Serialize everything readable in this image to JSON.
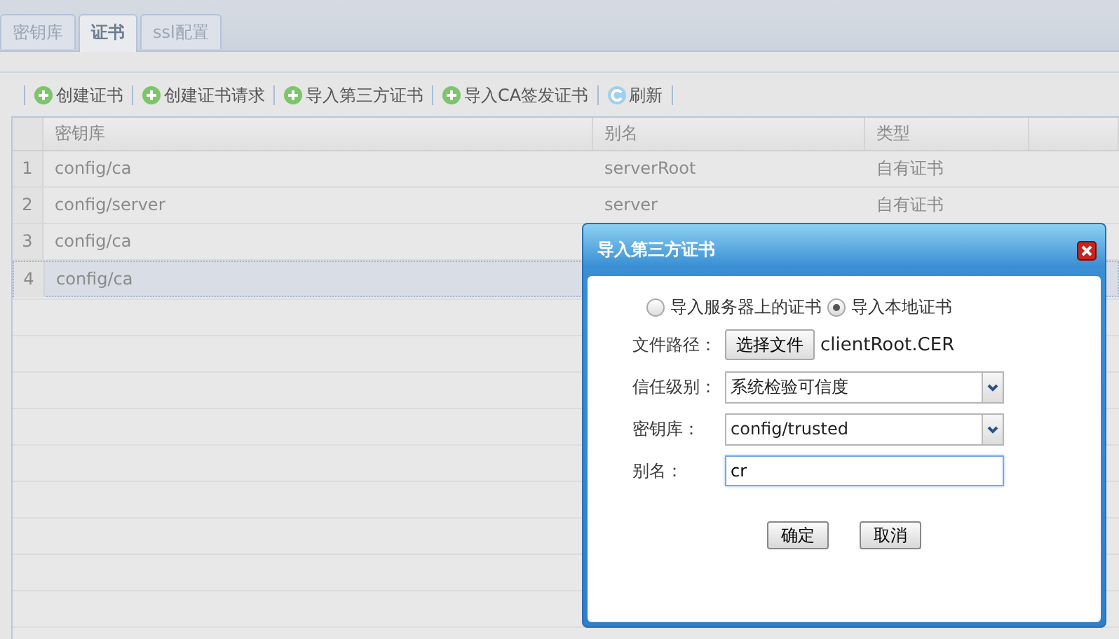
{
  "tabs": [
    {
      "label": "密钥库",
      "selected": false
    },
    {
      "label": "证书",
      "selected": true
    },
    {
      "label": "ssl配置",
      "selected": false
    }
  ],
  "toolbar": [
    {
      "label": "创建证书",
      "kind": "add"
    },
    {
      "label": "创建证书请求",
      "kind": "add"
    },
    {
      "label": "导入第三方证书",
      "kind": "add"
    },
    {
      "label": "导入CA签发证书",
      "kind": "add"
    },
    {
      "label": "刷新",
      "kind": "refresh"
    }
  ],
  "table": {
    "columns": [
      "密钥库",
      "别名",
      "类型"
    ],
    "rows": [
      {
        "number": "1",
        "cells": [
          "config/ca",
          "serverRoot",
          "自有证书"
        ],
        "selected": false
      },
      {
        "number": "2",
        "cells": [
          "config/server",
          "server",
          "自有证书"
        ],
        "selected": false
      },
      {
        "number": "3",
        "cells": [
          "config/ca"
        ],
        "selected": false
      },
      {
        "number": "4",
        "cells": [
          "config/ca"
        ],
        "selected": true
      }
    ]
  },
  "dialog": {
    "title": "导入第三方证书",
    "radios": [
      {
        "label": "导入服务器上的证书",
        "selected": false
      },
      {
        "label": "导入本地证书",
        "selected": true
      }
    ],
    "fields": [
      {
        "kind": "file",
        "label": "文件路径：",
        "button": "选择文件",
        "value": "clientRoot.CER"
      },
      {
        "kind": "select",
        "label": "信任级别：",
        "value": "系统检验可信度"
      },
      {
        "kind": "select",
        "label": "密钥库：",
        "value": "config/trusted"
      },
      {
        "kind": "text",
        "label": "别名：",
        "value": "cr"
      }
    ],
    "buttons": [
      "确定",
      "取消"
    ]
  }
}
